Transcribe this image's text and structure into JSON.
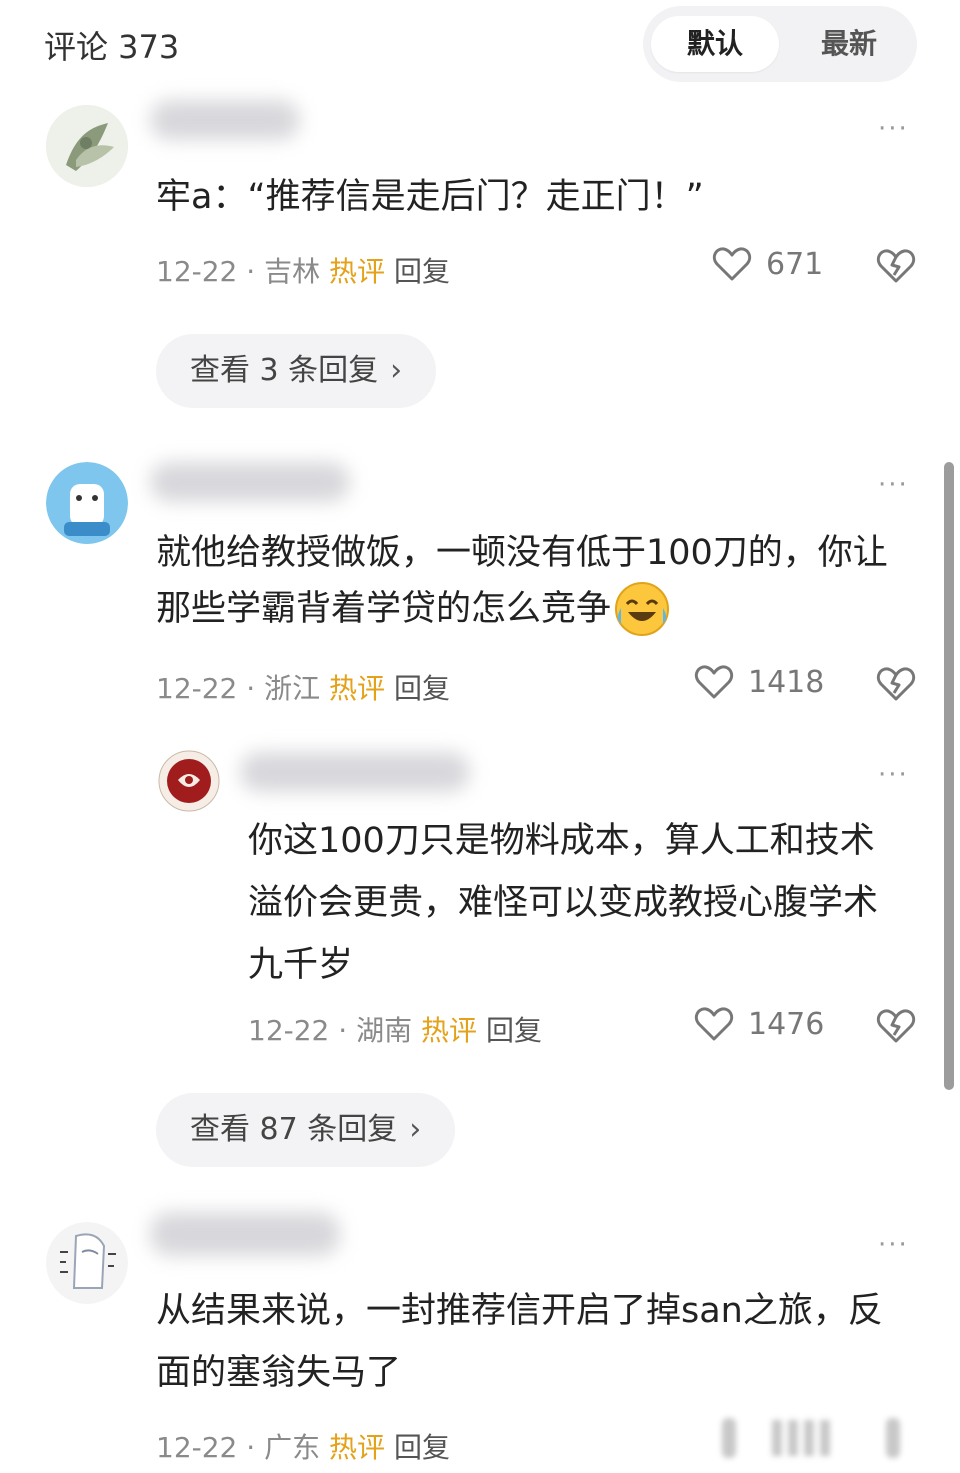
{
  "header": {
    "title": "评论 373",
    "sort_default": "默认",
    "sort_latest": "最新"
  },
  "comments": [
    {
      "text": "牢a：“推荐信是走后门？走正门！”",
      "date": "12-22",
      "location": "吉林",
      "hot": "热评",
      "reply": "回复",
      "likes": "671",
      "more_replies_prefix": "查看 3 条回复"
    },
    {
      "text_line1": "就他给教授做饭，一顿没有低于100刀的，你让",
      "text_line2": "那些学霸背着学贷的怎么竞争",
      "date": "12-22",
      "location": "浙江",
      "hot": "热评",
      "reply": "回复",
      "likes": "1418",
      "more_replies_prefix": "查看 87 条回复"
    },
    {
      "text_line1": "从结果来说，一封推荐信开启了掉san之旅，反",
      "text_line2": "面的塞翁失马了",
      "date": "12-22",
      "location": "广东",
      "hot": "热评",
      "reply": "回复"
    }
  ],
  "sub_reply": {
    "text_line1": "你这100刀只是物料成本，算人工和技术",
    "text_line2": "溢价会更贵，难怪可以变成教授心腹学术",
    "text_line3": "九千岁",
    "date": "12-22",
    "location": "湖南",
    "hot": "热评",
    "reply": "回复",
    "likes": "1476"
  },
  "ui": {
    "sep": "·",
    "more": "···",
    "chevron": "›",
    "like_icon": "heart-outline-icon",
    "dislike_icon": "broken-heart-icon"
  }
}
